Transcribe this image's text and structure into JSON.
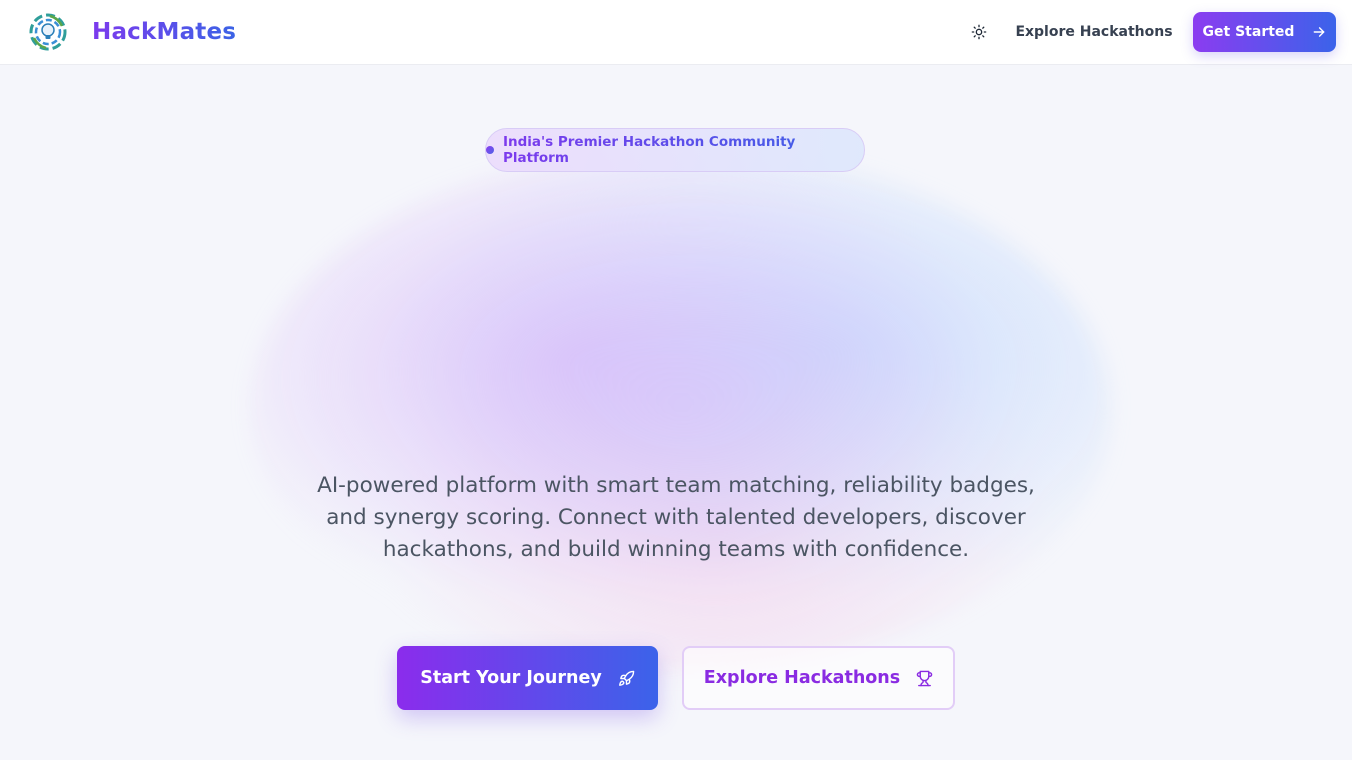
{
  "header": {
    "brand": "HackMates",
    "logo_icon": "hackmates-logo-icon",
    "theme_toggle_icon": "sun-icon",
    "explore_link": "Explore Hackathons",
    "get_started_label": "Get Started",
    "get_started_icon": "arrow-right-icon"
  },
  "hero": {
    "badge_text": "India's Premier Hackathon Community Platform",
    "description": "AI-powered platform with smart team matching, reliability badges, and synergy scoring. Connect with talented developers, discover hackathons, and build winning teams with confidence.",
    "primary_cta": {
      "label": "Start Your Journey",
      "icon": "rocket-icon"
    },
    "secondary_cta": {
      "label": "Explore Hackathons",
      "icon": "trophy-icon"
    }
  },
  "colors": {
    "accent_purple": "#8b3cf0",
    "accent_blue": "#3b63ea",
    "text_muted": "#4b5563",
    "background": "#f5f6fb"
  }
}
